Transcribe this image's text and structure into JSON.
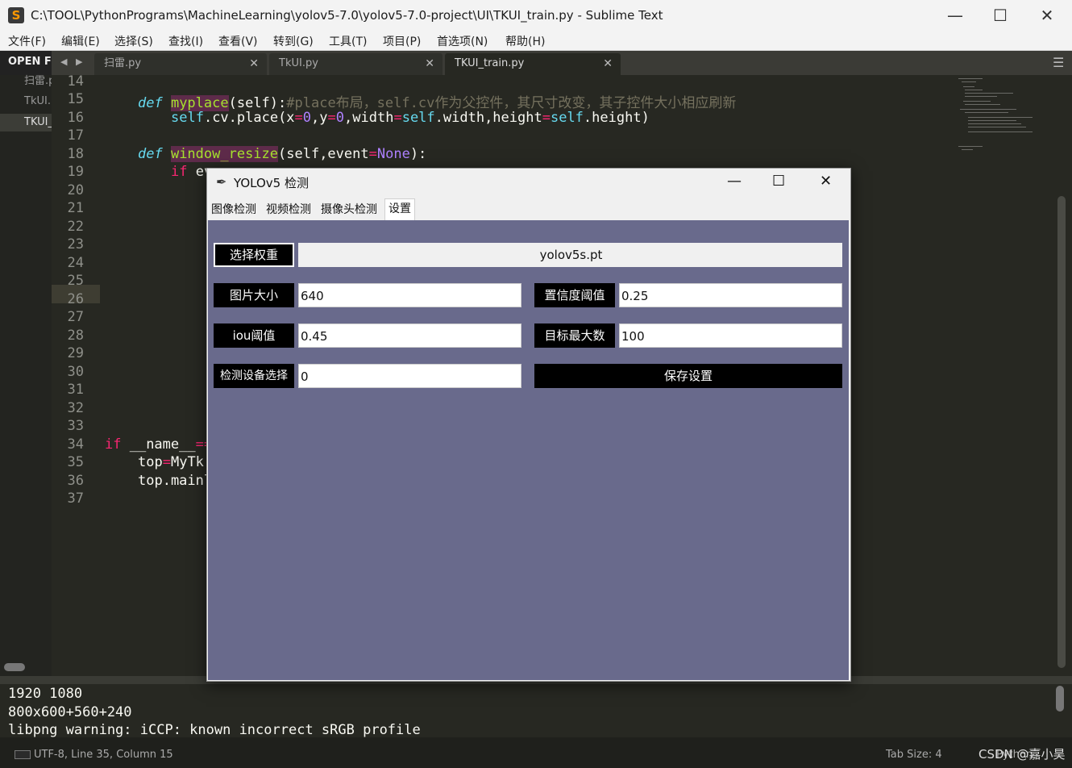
{
  "window": {
    "title": "C:\\TOOL\\PythonPrograms\\MachineLearning\\yolov5-7.0\\yolov5-7.0-project\\UI\\TKUI_train.py - Sublime Text",
    "app_icon": "S",
    "minimize": "—",
    "maximize": "☐",
    "close": "✕"
  },
  "menu": [
    "文件(F)",
    "编辑(E)",
    "选择(S)",
    "查找(I)",
    "查看(V)",
    "转到(G)",
    "工具(T)",
    "项目(P)",
    "首选项(N)",
    "帮助(H)"
  ],
  "sidebar": {
    "header": "OPEN FI",
    "files": [
      "扫雷.p",
      "TkUI.p",
      "TKUI_"
    ]
  },
  "tabs": [
    {
      "label": "扫雷.py",
      "close": "✕"
    },
    {
      "label": "TkUI.py",
      "close": "✕"
    },
    {
      "label": "TKUI_train.py",
      "close": "✕"
    }
  ],
  "nav": {
    "back": "◀",
    "forward": "▶",
    "menu": "☰"
  },
  "editor": {
    "line_numbers": [
      "14",
      "15",
      "16",
      "17",
      "18",
      "19",
      "20",
      "21",
      "22",
      "23",
      "24",
      "25",
      "26",
      "27",
      "28",
      "29",
      "30",
      "31",
      "32",
      "33",
      "34",
      "35",
      "36",
      "37"
    ],
    "lines": {
      "l15_def": "def ",
      "l15_fn": "myplace",
      "l15_rest": "(self):",
      "l15_comment": "#place布局，self.cv作为父控件，其尺寸改变，其子控件大小相应刷新",
      "l16_a": "self",
      "l16_b": ".cv.place(x",
      "l16_c": "=",
      "l16_d": "0",
      "l16_e": ",y",
      "l16_f": "=",
      "l16_g": "0",
      "l16_h": ",width",
      "l16_i": "=",
      "l16_j": "self",
      "l16_k": ".width,height",
      "l16_l": "=",
      "l16_m": "self",
      "l16_n": ".height)",
      "l18_def": "def ",
      "l18_fn": "window_resize",
      "l18_a": "(self,event",
      "l18_b": "=",
      "l18_c": "None",
      "l18_d": "):",
      "l19_if": "if ",
      "l19_rest": "ev",
      "l34_if": "if ",
      "l34_rest": "__name__",
      "l34_op": "==",
      "l35": "top",
      "l35_op": "=",
      "l35_rest": "MyTk",
      "l36": "top.mainl"
    }
  },
  "console": [
    "1920 1080",
    "800x600+560+240",
    "libpng warning: iCCP: known incorrect sRGB profile"
  ],
  "status": {
    "left": "UTF-8, Line 35, Column 15",
    "tab_size": "Tab Size: 4",
    "lang": "Python",
    "watermark": "CSDN @嘉小昊"
  },
  "tk": {
    "title": "YOLOv5 检测",
    "feather_icon": "✒",
    "minimize": "—",
    "maximize": "☐",
    "close": "✕",
    "tabs": [
      "图像检测",
      "视频检测",
      "摄像头检测",
      "设置"
    ],
    "weight_button": "选择权重",
    "weight_value": "yolov5s.pt",
    "img_size_label": "图片大小",
    "img_size_value": "640",
    "conf_label": "置信度阈值",
    "conf_value": "0.25",
    "iou_label": "iou阈值",
    "iou_value": "0.45",
    "max_det_label": "目标最大数",
    "max_det_value": "100",
    "device_label": "检测设备选择",
    "device_value": "0",
    "save_button": "保存设置"
  },
  "colors": {
    "editor_bg": "#272822",
    "tk_body": "#696a8c",
    "keyword": "#66d9ef",
    "function": "#a6e22e",
    "number": "#ae81ff",
    "operator": "#f92672",
    "comment": "#75715e"
  }
}
